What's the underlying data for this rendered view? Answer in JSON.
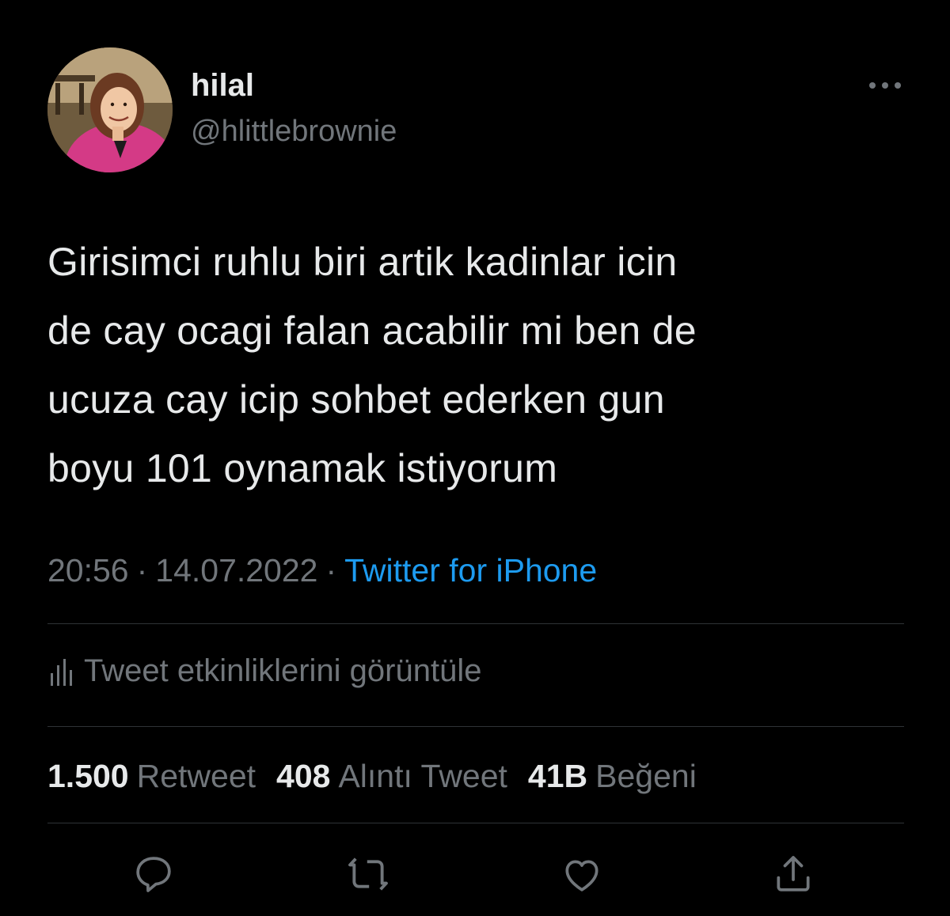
{
  "author": {
    "display_name": "hilal",
    "handle": "@hlittlebrownie",
    "avatar_icon": "profile-photo"
  },
  "tweet": {
    "text_lines": [
      "Girisimci ruhlu biri artik kadinlar icin",
      "de cay ocagi falan acabilir mi ben de",
      "ucuza cay icip sohbet ederken gun",
      "boyu 101 oynamak istiyorum"
    ]
  },
  "meta": {
    "time": "20:56",
    "date": "14.07.2022",
    "separator": "·",
    "source": "Twitter for iPhone"
  },
  "analytics": {
    "label": "Tweet etkinliklerini görüntüle",
    "icon": "bar-chart-icon"
  },
  "stats": {
    "retweets": {
      "count": "1.500",
      "label": "Retweet"
    },
    "quotes": {
      "count": "408",
      "label": "Alıntı Tweet"
    },
    "likes": {
      "count": "41B",
      "label": "Beğeni"
    }
  },
  "actions": {
    "icons": [
      "reply-icon",
      "retweet-icon",
      "like-icon",
      "share-icon"
    ]
  },
  "colors": {
    "background": "#000000",
    "text": "#e7e9ea",
    "secondary": "#71767b",
    "link": "#1d9bf0",
    "divider": "#2f3336"
  }
}
